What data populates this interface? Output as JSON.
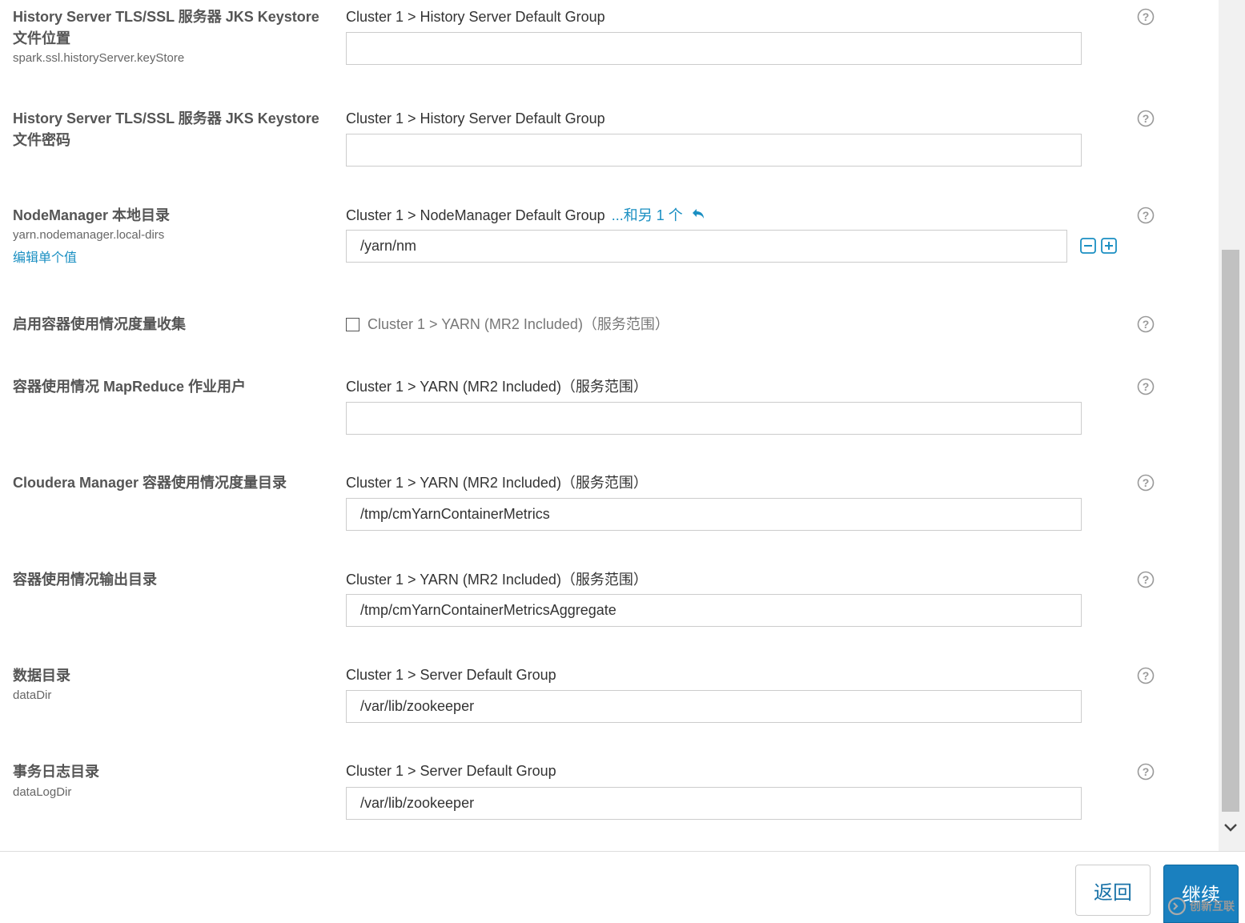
{
  "rows": [
    {
      "title_lines": [
        "History Server TLS/SSL 服务器 JKS Keystore",
        "文件位置"
      ],
      "key": "spark.ssl.historyServer.keyStore",
      "scope": "Cluster 1 > History Server Default Group",
      "value": ""
    },
    {
      "title_lines": [
        "History Server TLS/SSL 服务器 JKS Keystore",
        "文件密码"
      ],
      "scope": "Cluster 1 > History Server Default Group",
      "value": ""
    },
    {
      "title": "NodeManager 本地目录",
      "key": "yarn.nodemanager.local-dirs",
      "edit_link": "编辑单个值",
      "scope": "Cluster 1 > NodeManager Default Group",
      "more": "...和另 1 个",
      "value": "/yarn/nm"
    },
    {
      "title": "启用容器使用情况度量收集",
      "checkbox_label": "Cluster 1 > YARN (MR2 Included)（服务范围）",
      "checked": false
    },
    {
      "title": "容器使用情况 MapReduce 作业用户",
      "scope": "Cluster 1 > YARN (MR2 Included)（服务范围）",
      "value": ""
    },
    {
      "title": "Cloudera Manager 容器使用情况度量目录",
      "scope": "Cluster 1 > YARN (MR2 Included)（服务范围）",
      "value": "/tmp/cmYarnContainerMetrics"
    },
    {
      "title": "容器使用情况输出目录",
      "scope": "Cluster 1 > YARN (MR2 Included)（服务范围）",
      "value": "/tmp/cmYarnContainerMetricsAggregate"
    },
    {
      "title": "数据目录",
      "key": "dataDir",
      "scope": "Cluster 1 > Server Default Group",
      "value": "/var/lib/zookeeper"
    },
    {
      "title": "事务日志目录",
      "key": "dataLogDir",
      "scope": "Cluster 1 > Server Default Group",
      "value": "/var/lib/zookeeper"
    }
  ],
  "footer": {
    "back_label": "返回",
    "next_label": "继续"
  },
  "watermark": {
    "text": "创新互联"
  },
  "colors": {
    "link": "#1a8fc2",
    "primary_button": "#1a80bf"
  }
}
